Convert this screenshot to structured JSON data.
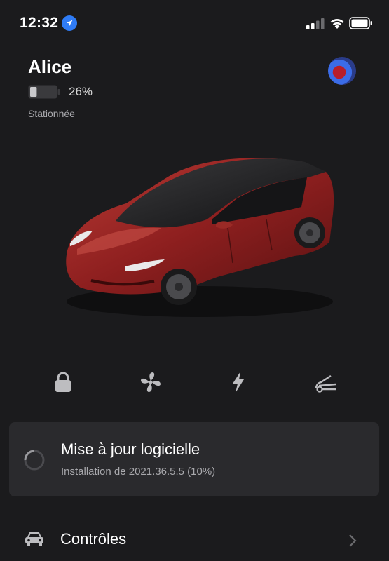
{
  "status_bar": {
    "time": "12:32",
    "location_icon": "location-arrow-icon",
    "signal_icon": "cellular-signal-icon",
    "wifi_icon": "wifi-icon",
    "battery_icon": "battery-icon"
  },
  "vehicle": {
    "name": "Alice",
    "battery_percent": "26%",
    "battery_level": 0.26,
    "state": "Stationnée"
  },
  "quick_actions": [
    {
      "icon": "lock-icon"
    },
    {
      "icon": "fan-icon"
    },
    {
      "icon": "lightning-icon"
    },
    {
      "icon": "frunk-icon"
    }
  ],
  "update": {
    "title": "Mise à jour logicielle",
    "subtitle": "Installation de 2021.36.5.5 (10%)"
  },
  "controls": {
    "label": "Contrôles",
    "icon": "car-front-icon"
  },
  "colors": {
    "background": "#1b1b1d",
    "card": "#2a2a2d",
    "accent_blue": "#2f7cf6",
    "car_red": "#8e1f1f",
    "icon_gray": "#bdbdc0"
  }
}
